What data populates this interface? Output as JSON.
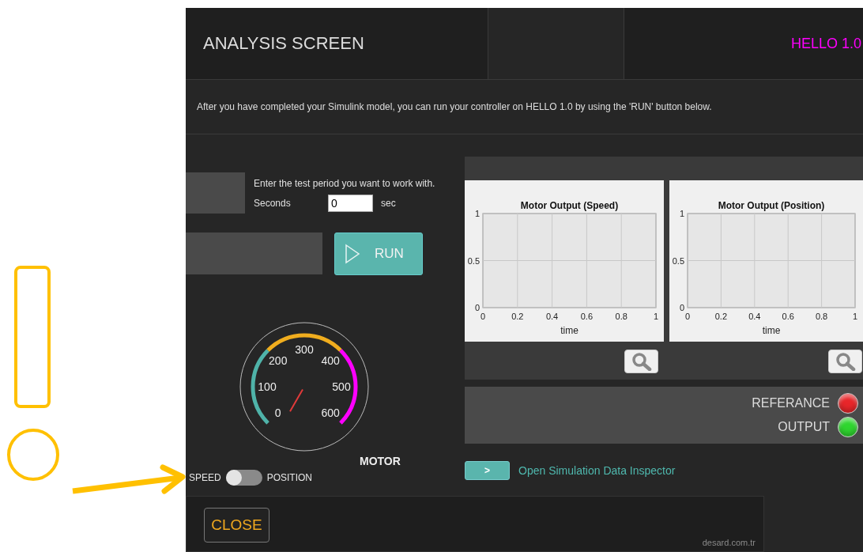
{
  "header": {
    "title": "ANALYSIS SCREEN",
    "version": "HELLO 1.0"
  },
  "info": "After you have completed your Simulink model, you can run your controller on HELLO 1.0 by using the 'RUN' button below.",
  "test_period": {
    "prompt": "Enter the test period you want to work with.",
    "label": "Seconds",
    "value": "0",
    "unit": "sec"
  },
  "run_button": {
    "label": "RUN"
  },
  "gauge": {
    "title": "MOTOR",
    "ticks": [
      "0",
      "100",
      "200",
      "300",
      "400",
      "500",
      "600"
    ]
  },
  "mode_switch": {
    "left_label": "SPEED",
    "right_label": "POSITION",
    "on": false
  },
  "charts": [
    {
      "chart_data": {
        "type": "line",
        "grid": true,
        "title": "Motor Output (Speed)",
        "xlabel": "time",
        "xlim": [
          0,
          1
        ],
        "ylim": [
          0,
          1
        ],
        "xticks": [
          0,
          0.2,
          0.4,
          0.6,
          0.8,
          1
        ],
        "yticks": [
          0,
          0.5,
          1
        ]
      }
    },
    {
      "chart_data": {
        "type": "line",
        "grid": true,
        "title": "Motor Output (Position)",
        "xlabel": "time",
        "xlim": [
          0,
          1
        ],
        "ylim": [
          0,
          1
        ],
        "xticks": [
          0,
          0.2,
          0.4,
          0.6,
          0.8,
          1
        ],
        "yticks": [
          0,
          0.5,
          1
        ]
      }
    }
  ],
  "lamps": [
    {
      "label": "REFERANCE",
      "color": "#e8262a"
    },
    {
      "label": "OUTPUT",
      "color": "#2fd62f"
    }
  ],
  "inspector": {
    "button_label": ">",
    "link": "Open Simulation Data Inspector"
  },
  "footer": {
    "close": "CLOSE",
    "credit": "desard.com.tr"
  }
}
